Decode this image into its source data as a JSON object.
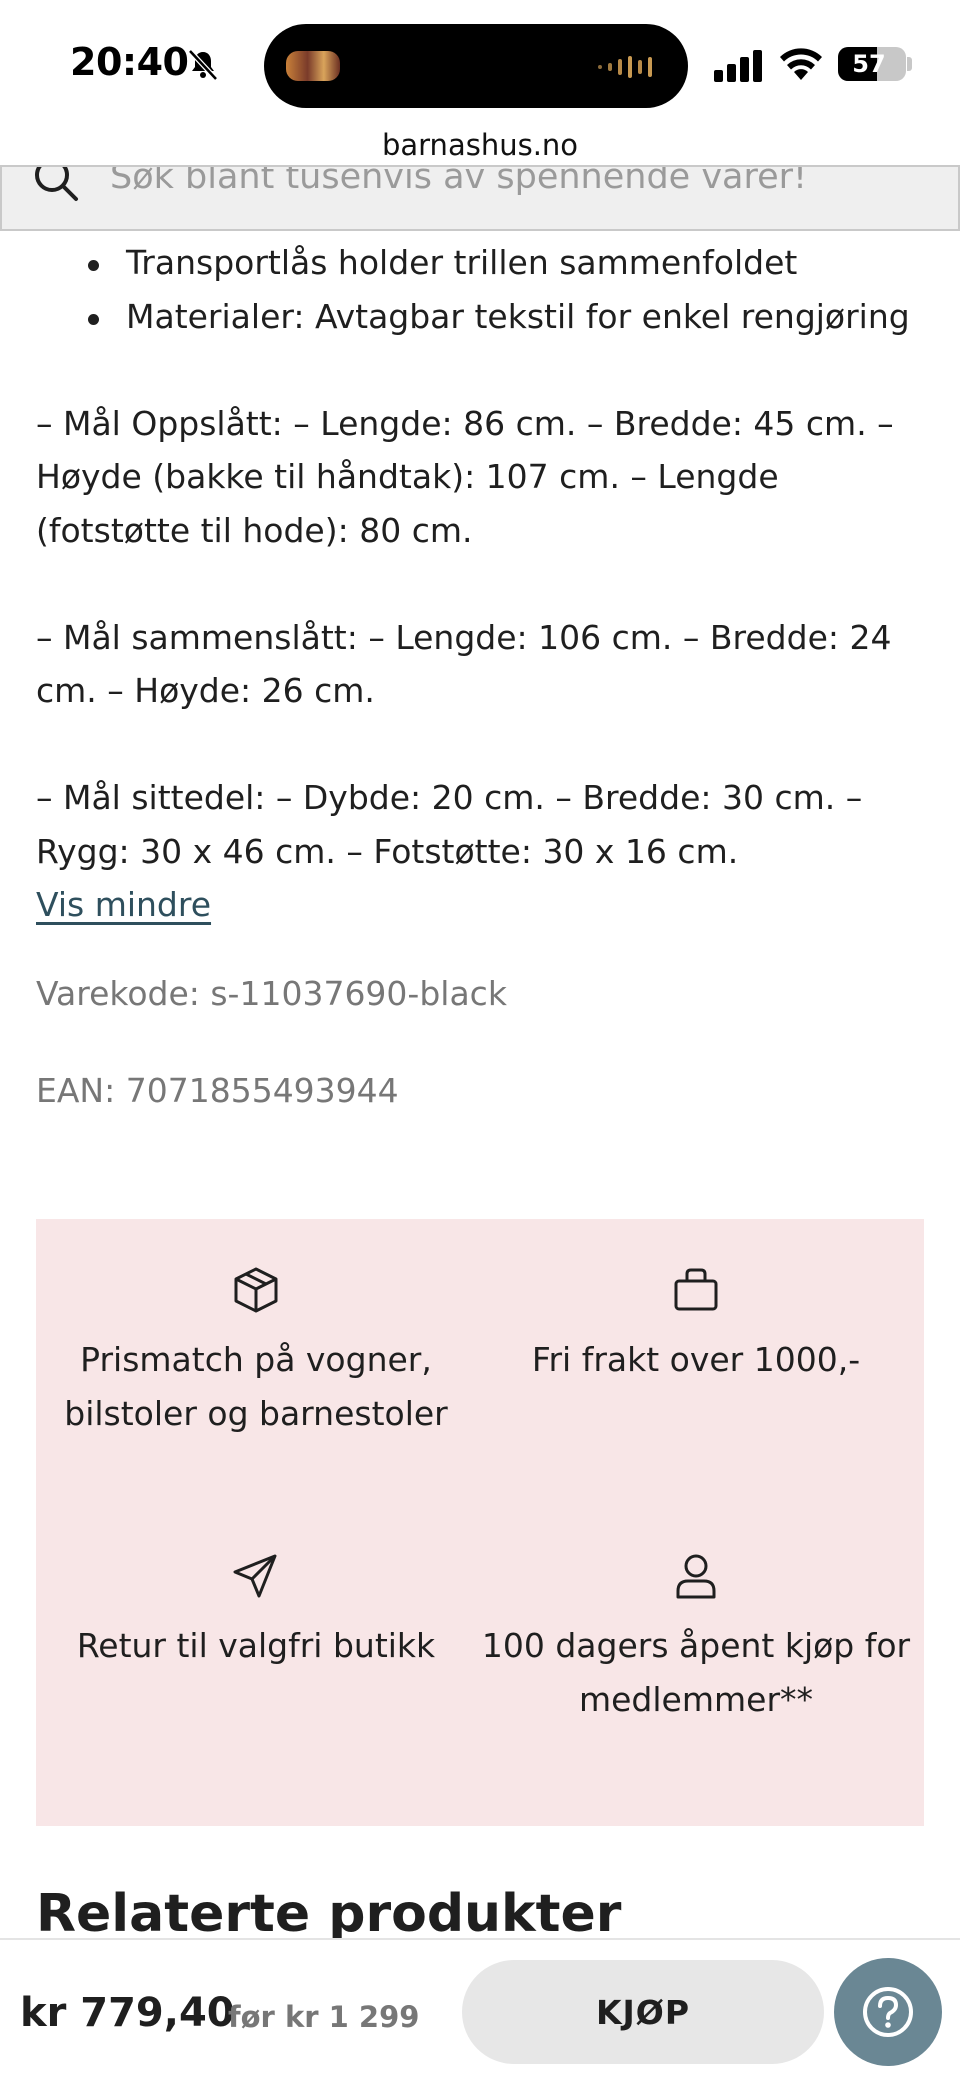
{
  "status_bar": {
    "time": "20:40",
    "battery": "57",
    "battery_level_percent": 57
  },
  "browser": {
    "url": "barnashus.no"
  },
  "search": {
    "placeholder": "Søk blant tusenvis av spennende varer!"
  },
  "description": {
    "bullets": [
      "Transportlås holder trillen sammenfoldet",
      "Materialer: Avtagbar tekstil for enkel rengjøring"
    ],
    "paragraphs": [
      "– Mål Oppslått: – Lengde: 86 cm. – Bredde: 45 cm. – Høyde (bakke til håndtak): 107 cm. – Lengde (fotstøtte til hode): 80 cm.",
      "– Mål sammenslått: – Lengde: 106 cm. – Bredde: 24 cm. – Høyde: 26 cm.",
      "– Mål sittedel: – Dybde: 20 cm. – Bredde: 30 cm. – Rygg: 30 x 46 cm. – Fotstøtte: 30 x 16 cm."
    ],
    "toggle_label": "Vis mindre"
  },
  "product_meta": {
    "sku": "Varekode: s-11037690-black",
    "ean": "EAN: 7071855493944"
  },
  "features": [
    {
      "icon": "package-icon",
      "label": "Prismatch på vogner, bilstoler og barnestoler"
    },
    {
      "icon": "shopping-bag-icon",
      "label": "Fri frakt over 1000,-"
    },
    {
      "icon": "send-icon",
      "label": "Retur til valgfri butikk"
    },
    {
      "icon": "user-icon",
      "label": "100 dagers åpent kjøp for medlemmer**"
    }
  ],
  "related": {
    "title": "Relaterte produkter"
  },
  "purchase_bar": {
    "price": "kr 779,40",
    "old_price": "før kr 1 299",
    "buy_label": "KJØP",
    "help_icon": "help-icon"
  },
  "colors": {
    "feature_background": "#f8e6e7",
    "link": "#2e4f5d",
    "help_button": "#6a8794",
    "buy_button": "#e7e7e7"
  }
}
